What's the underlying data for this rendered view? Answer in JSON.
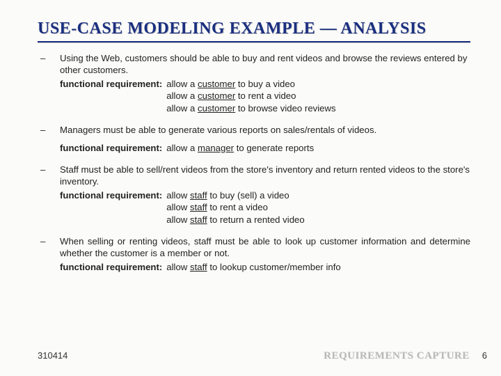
{
  "title": "USE-CASE MODELING EXAMPLE — ANALYSIS",
  "fr_label": "functional requirement:",
  "bullets": [
    {
      "para": "Using the Web, customers should be able to buy and rent videos and browse the reviews entered by other customers.",
      "justify": false,
      "fr": [
        {
          "pre": "allow a ",
          "actor": "customer",
          "post": " to buy a video"
        },
        {
          "pre": "allow a ",
          "actor": "customer",
          "post": " to rent a video"
        },
        {
          "pre": "allow a ",
          "actor": "customer",
          "post": " to browse video reviews"
        }
      ]
    },
    {
      "para": "Managers must be able to generate various reports on sales/rentals of videos.",
      "justify": false,
      "gap": true,
      "fr": [
        {
          "pre": "allow a ",
          "actor": "manager",
          "post": " to generate reports"
        }
      ]
    },
    {
      "para": "Staff must be able to sell/rent videos from the store's inventory and return rented videos to the store's inventory.",
      "justify": false,
      "fr": [
        {
          "pre": "allow ",
          "actor": "staff",
          "post": " to buy (sell) a video"
        },
        {
          "pre": "allow ",
          "actor": "staff",
          "post": " to rent a video"
        },
        {
          "pre": "allow ",
          "actor": "staff",
          "post": " to return a rented video"
        }
      ]
    },
    {
      "para": "When selling or renting videos, staff must be able to look up customer information and determine whether the customer is a member or not.",
      "justify": true,
      "fr": [
        {
          "pre": "allow ",
          "actor": "staff",
          "post": " to lookup customer/member info"
        }
      ]
    }
  ],
  "footer": {
    "left": "310414",
    "right": "REQUIREMENTS CAPTURE",
    "page": "6"
  }
}
